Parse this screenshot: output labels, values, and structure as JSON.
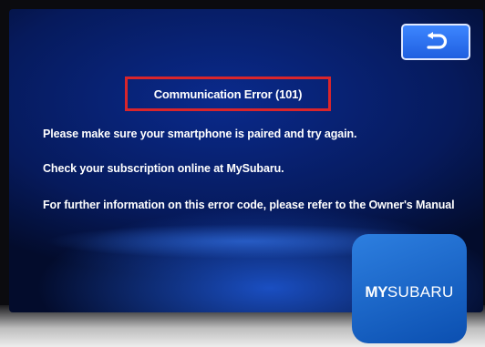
{
  "dialog": {
    "title": "Communication Error (101)",
    "line1": "Please make sure your smartphone is paired and try again.",
    "line2": "Check your subscription online at MySubaru.",
    "line3": "For further information on this error code, please refer to the Owner's Manual"
  },
  "back_button": {
    "icon": "return-arrow-icon"
  },
  "app_icon": {
    "logo_prefix": "MY",
    "logo_suffix": "SUBARU"
  },
  "colors": {
    "screen_blue": "#0a2a8c",
    "button_blue": "#2f74f0",
    "highlight_red": "#d9252b",
    "app_icon_blue": "#1a66cc"
  }
}
